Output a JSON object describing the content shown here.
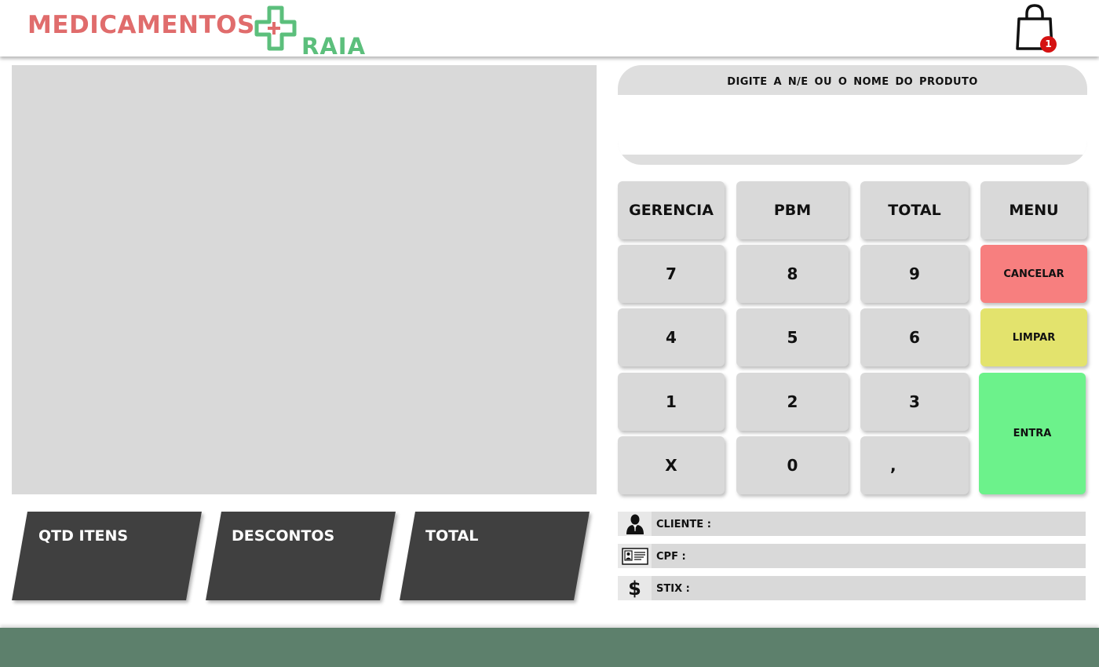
{
  "header": {
    "logo_left": "MEDICAMENTOS",
    "logo_right": "RAIA",
    "cart_icon": "shopping-bag-icon",
    "cart_count": "1",
    "colors": {
      "medicamentos": "#e06c6c",
      "raia": "#5cbf7c",
      "badge": "#d51212"
    }
  },
  "search": {
    "label": "DIGITE  A N/E OU O NOME DO PRODUTO",
    "value": "",
    "placeholder": ""
  },
  "keypad": {
    "gerencia": "GERENCIA",
    "pbm": "PBM",
    "total": "TOTAL",
    "menu": "MENU",
    "k7": "7",
    "k8": "8",
    "k9": "9",
    "k4": "4",
    "k5": "5",
    "k6": "6",
    "k1": "1",
    "k2": "2",
    "k3": "3",
    "kx": "X",
    "k0": "0",
    "kcomma": ",",
    "cancelar": "CANCELAR",
    "limpar": "LIMPAR",
    "entra": "ENTRA",
    "colors": {
      "cancelar": "#f77f7f",
      "limpar": "#e3e36d",
      "entra": "#6cf28b",
      "key": "#d9d9d9"
    }
  },
  "summary": {
    "qtd_itens": "QTD ITENS",
    "descontos": "DESCONTOS",
    "total": "TOTAL",
    "panel_color": "#404040"
  },
  "info": {
    "cliente": "CLIENTE :",
    "cpf": "CPF :",
    "stix": "STIX :",
    "icons": [
      "person-icon",
      "id-card-icon",
      "dollar-icon"
    ]
  },
  "footer": {
    "color": "#5d806c"
  }
}
